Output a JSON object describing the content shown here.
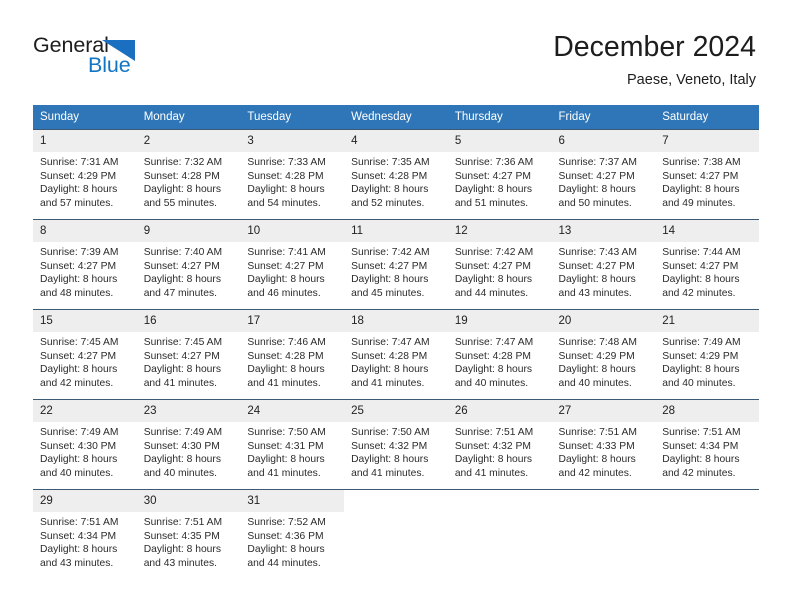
{
  "brand": {
    "name_part1": "General",
    "name_part2": "Blue",
    "logo_icon": "triangle-icon",
    "color_dark": "#1d1d1d",
    "color_blue": "#1275c4"
  },
  "header": {
    "title": "December 2024",
    "location": "Paese, Veneto, Italy",
    "accent_color": "#2e76b8"
  },
  "calendar": {
    "weekday_headers": [
      "Sunday",
      "Monday",
      "Tuesday",
      "Wednesday",
      "Thursday",
      "Friday",
      "Saturday"
    ],
    "weeks": [
      [
        {
          "day": "1",
          "sunrise": "Sunrise: 7:31 AM",
          "sunset": "Sunset: 4:29 PM",
          "daylight1": "Daylight: 8 hours",
          "daylight2": "and 57 minutes."
        },
        {
          "day": "2",
          "sunrise": "Sunrise: 7:32 AM",
          "sunset": "Sunset: 4:28 PM",
          "daylight1": "Daylight: 8 hours",
          "daylight2": "and 55 minutes."
        },
        {
          "day": "3",
          "sunrise": "Sunrise: 7:33 AM",
          "sunset": "Sunset: 4:28 PM",
          "daylight1": "Daylight: 8 hours",
          "daylight2": "and 54 minutes."
        },
        {
          "day": "4",
          "sunrise": "Sunrise: 7:35 AM",
          "sunset": "Sunset: 4:28 PM",
          "daylight1": "Daylight: 8 hours",
          "daylight2": "and 52 minutes."
        },
        {
          "day": "5",
          "sunrise": "Sunrise: 7:36 AM",
          "sunset": "Sunset: 4:27 PM",
          "daylight1": "Daylight: 8 hours",
          "daylight2": "and 51 minutes."
        },
        {
          "day": "6",
          "sunrise": "Sunrise: 7:37 AM",
          "sunset": "Sunset: 4:27 PM",
          "daylight1": "Daylight: 8 hours",
          "daylight2": "and 50 minutes."
        },
        {
          "day": "7",
          "sunrise": "Sunrise: 7:38 AM",
          "sunset": "Sunset: 4:27 PM",
          "daylight1": "Daylight: 8 hours",
          "daylight2": "and 49 minutes."
        }
      ],
      [
        {
          "day": "8",
          "sunrise": "Sunrise: 7:39 AM",
          "sunset": "Sunset: 4:27 PM",
          "daylight1": "Daylight: 8 hours",
          "daylight2": "and 48 minutes."
        },
        {
          "day": "9",
          "sunrise": "Sunrise: 7:40 AM",
          "sunset": "Sunset: 4:27 PM",
          "daylight1": "Daylight: 8 hours",
          "daylight2": "and 47 minutes."
        },
        {
          "day": "10",
          "sunrise": "Sunrise: 7:41 AM",
          "sunset": "Sunset: 4:27 PM",
          "daylight1": "Daylight: 8 hours",
          "daylight2": "and 46 minutes."
        },
        {
          "day": "11",
          "sunrise": "Sunrise: 7:42 AM",
          "sunset": "Sunset: 4:27 PM",
          "daylight1": "Daylight: 8 hours",
          "daylight2": "and 45 minutes."
        },
        {
          "day": "12",
          "sunrise": "Sunrise: 7:42 AM",
          "sunset": "Sunset: 4:27 PM",
          "daylight1": "Daylight: 8 hours",
          "daylight2": "and 44 minutes."
        },
        {
          "day": "13",
          "sunrise": "Sunrise: 7:43 AM",
          "sunset": "Sunset: 4:27 PM",
          "daylight1": "Daylight: 8 hours",
          "daylight2": "and 43 minutes."
        },
        {
          "day": "14",
          "sunrise": "Sunrise: 7:44 AM",
          "sunset": "Sunset: 4:27 PM",
          "daylight1": "Daylight: 8 hours",
          "daylight2": "and 42 minutes."
        }
      ],
      [
        {
          "day": "15",
          "sunrise": "Sunrise: 7:45 AM",
          "sunset": "Sunset: 4:27 PM",
          "daylight1": "Daylight: 8 hours",
          "daylight2": "and 42 minutes."
        },
        {
          "day": "16",
          "sunrise": "Sunrise: 7:45 AM",
          "sunset": "Sunset: 4:27 PM",
          "daylight1": "Daylight: 8 hours",
          "daylight2": "and 41 minutes."
        },
        {
          "day": "17",
          "sunrise": "Sunrise: 7:46 AM",
          "sunset": "Sunset: 4:28 PM",
          "daylight1": "Daylight: 8 hours",
          "daylight2": "and 41 minutes."
        },
        {
          "day": "18",
          "sunrise": "Sunrise: 7:47 AM",
          "sunset": "Sunset: 4:28 PM",
          "daylight1": "Daylight: 8 hours",
          "daylight2": "and 41 minutes."
        },
        {
          "day": "19",
          "sunrise": "Sunrise: 7:47 AM",
          "sunset": "Sunset: 4:28 PM",
          "daylight1": "Daylight: 8 hours",
          "daylight2": "and 40 minutes."
        },
        {
          "day": "20",
          "sunrise": "Sunrise: 7:48 AM",
          "sunset": "Sunset: 4:29 PM",
          "daylight1": "Daylight: 8 hours",
          "daylight2": "and 40 minutes."
        },
        {
          "day": "21",
          "sunrise": "Sunrise: 7:49 AM",
          "sunset": "Sunset: 4:29 PM",
          "daylight1": "Daylight: 8 hours",
          "daylight2": "and 40 minutes."
        }
      ],
      [
        {
          "day": "22",
          "sunrise": "Sunrise: 7:49 AM",
          "sunset": "Sunset: 4:30 PM",
          "daylight1": "Daylight: 8 hours",
          "daylight2": "and 40 minutes."
        },
        {
          "day": "23",
          "sunrise": "Sunrise: 7:49 AM",
          "sunset": "Sunset: 4:30 PM",
          "daylight1": "Daylight: 8 hours",
          "daylight2": "and 40 minutes."
        },
        {
          "day": "24",
          "sunrise": "Sunrise: 7:50 AM",
          "sunset": "Sunset: 4:31 PM",
          "daylight1": "Daylight: 8 hours",
          "daylight2": "and 41 minutes."
        },
        {
          "day": "25",
          "sunrise": "Sunrise: 7:50 AM",
          "sunset": "Sunset: 4:32 PM",
          "daylight1": "Daylight: 8 hours",
          "daylight2": "and 41 minutes."
        },
        {
          "day": "26",
          "sunrise": "Sunrise: 7:51 AM",
          "sunset": "Sunset: 4:32 PM",
          "daylight1": "Daylight: 8 hours",
          "daylight2": "and 41 minutes."
        },
        {
          "day": "27",
          "sunrise": "Sunrise: 7:51 AM",
          "sunset": "Sunset: 4:33 PM",
          "daylight1": "Daylight: 8 hours",
          "daylight2": "and 42 minutes."
        },
        {
          "day": "28",
          "sunrise": "Sunrise: 7:51 AM",
          "sunset": "Sunset: 4:34 PM",
          "daylight1": "Daylight: 8 hours",
          "daylight2": "and 42 minutes."
        }
      ],
      [
        {
          "day": "29",
          "sunrise": "Sunrise: 7:51 AM",
          "sunset": "Sunset: 4:34 PM",
          "daylight1": "Daylight: 8 hours",
          "daylight2": "and 43 minutes."
        },
        {
          "day": "30",
          "sunrise": "Sunrise: 7:51 AM",
          "sunset": "Sunset: 4:35 PM",
          "daylight1": "Daylight: 8 hours",
          "daylight2": "and 43 minutes."
        },
        {
          "day": "31",
          "sunrise": "Sunrise: 7:52 AM",
          "sunset": "Sunset: 4:36 PM",
          "daylight1": "Daylight: 8 hours",
          "daylight2": "and 44 minutes."
        },
        {
          "day": "",
          "sunrise": "",
          "sunset": "",
          "daylight1": "",
          "daylight2": ""
        },
        {
          "day": "",
          "sunrise": "",
          "sunset": "",
          "daylight1": "",
          "daylight2": ""
        },
        {
          "day": "",
          "sunrise": "",
          "sunset": "",
          "daylight1": "",
          "daylight2": ""
        },
        {
          "day": "",
          "sunrise": "",
          "sunset": "",
          "daylight1": "",
          "daylight2": ""
        }
      ]
    ]
  }
}
